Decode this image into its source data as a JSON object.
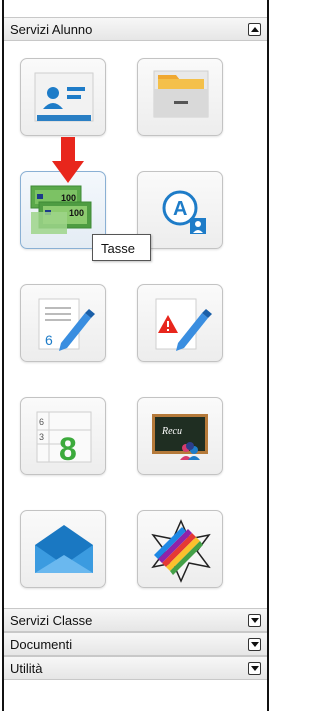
{
  "panels": {
    "servizi_alunno": {
      "label": "Servizi Alunno",
      "state": "expanded"
    },
    "servizi_classe": {
      "label": "Servizi Classe",
      "state": "collapsed"
    },
    "documenti": {
      "label": "Documenti",
      "state": "collapsed"
    },
    "utilita": {
      "label": "Utilità",
      "state": "collapsed"
    }
  },
  "tiles": [
    {
      "icon": "student-id-card-icon"
    },
    {
      "icon": "folder-drawer-icon"
    },
    {
      "icon": "money-banknotes-icon",
      "selected": true
    },
    {
      "icon": "student-grade-a-icon"
    },
    {
      "icon": "grade-pencil-icon"
    },
    {
      "icon": "notes-warning-pencil-icon"
    },
    {
      "icon": "grade-calendar-icon"
    },
    {
      "icon": "recovery-blackboard-icon"
    },
    {
      "icon": "messages-envelope-icon"
    },
    {
      "icon": "colorful-star-icon"
    }
  ],
  "tooltip": {
    "text": "Tasse"
  },
  "colors": {
    "accent_blue": "#1e90d6",
    "arrow_red": "#e8261c",
    "money_green": "#4caf50"
  }
}
